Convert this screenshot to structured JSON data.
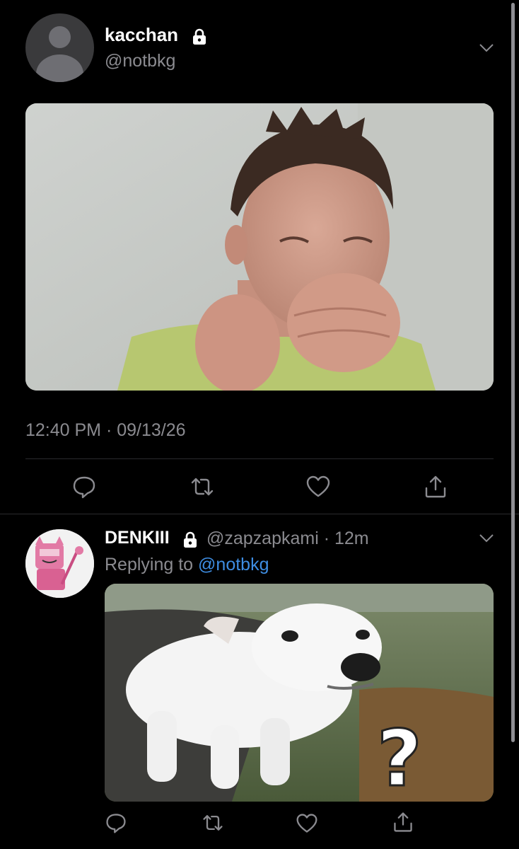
{
  "tweet": {
    "display_name": "kacchan",
    "handle": "@notbkg",
    "timestamp": "12:40 PM · 09/13/26"
  },
  "reply": {
    "display_name": "DENKIII",
    "handle": "@zapzapkami · 12m",
    "replying_prefix": "Replying to",
    "replying_mention": "@notbkg",
    "image_overlay_text": "?"
  },
  "icons": {
    "lock": "lock-icon",
    "chevron": "chevron-down-icon",
    "reply": "reply-icon",
    "retweet": "retweet-icon",
    "like": "heart-icon",
    "share": "share-icon"
  },
  "colors": {
    "background": "#000000",
    "secondary_text": "#8b8b90",
    "link": "#3e8de2",
    "divider": "#2a2a2d"
  }
}
